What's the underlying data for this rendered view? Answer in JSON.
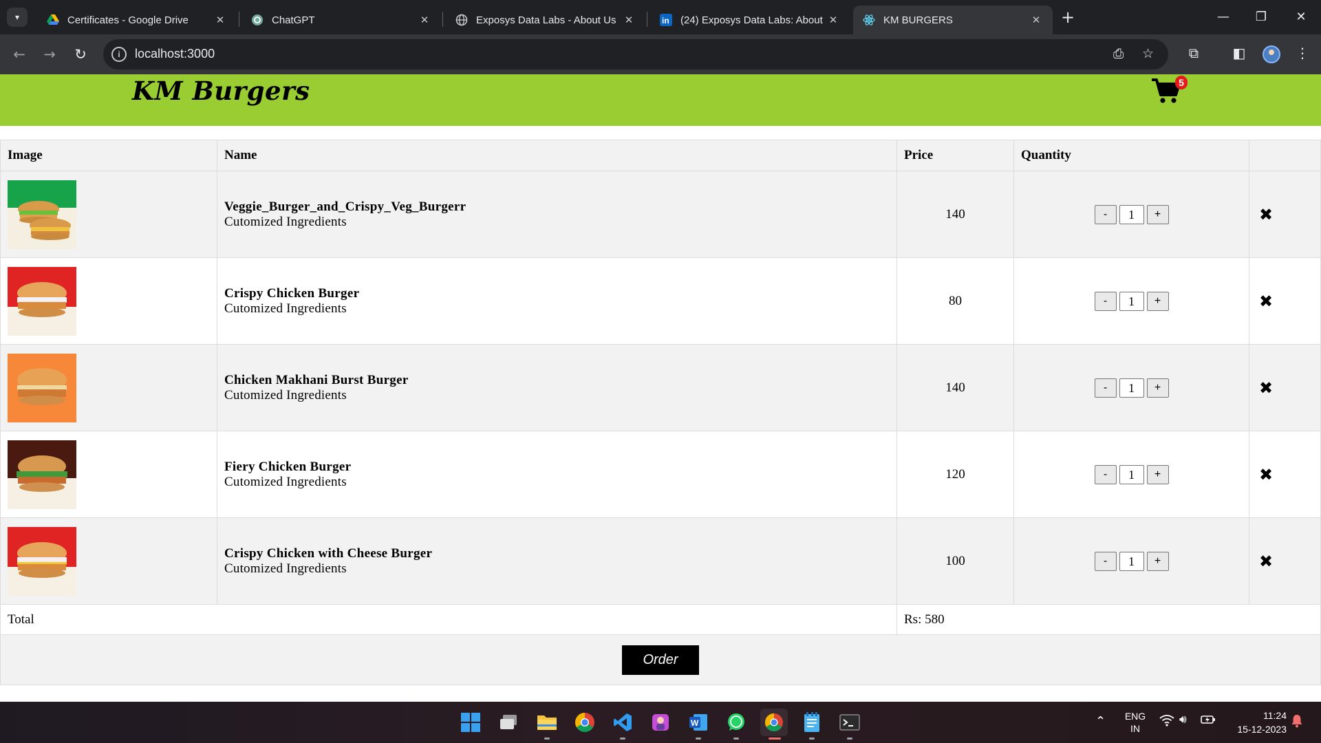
{
  "browser": {
    "tabs": [
      {
        "title": "Certificates - Google Drive",
        "icon": "google-drive-icon"
      },
      {
        "title": "ChatGPT",
        "icon": "chatgpt-icon"
      },
      {
        "title": "Exposys Data Labs - About Us",
        "icon": "globe-icon"
      },
      {
        "title": "(24) Exposys Data Labs: About |",
        "icon": "linkedin-icon"
      },
      {
        "title": "KM BURGERS",
        "icon": "react-icon",
        "active": true
      }
    ],
    "url": "localhost:3000"
  },
  "site": {
    "brand": "KM Burgers",
    "cart_count": "5",
    "accent_color": "#9acd32"
  },
  "table": {
    "headers": {
      "image": "Image",
      "name": "Name",
      "price": "Price",
      "quantity": "Quantity"
    },
    "items": [
      {
        "name": "Veggie_Burger_and_Crispy_Veg_Burgerr",
        "subtitle": "Cutomized Ingredients",
        "price": "140",
        "qty": "1",
        "image": "veggie-burger-image"
      },
      {
        "name": "Crispy Chicken Burger",
        "subtitle": "Cutomized Ingredients",
        "price": "80",
        "qty": "1",
        "image": "crispy-chicken-burger-image"
      },
      {
        "name": "Chicken Makhani Burst Burger",
        "subtitle": "Cutomized Ingredients",
        "price": "140",
        "qty": "1",
        "image": "chicken-makhani-burger-image"
      },
      {
        "name": "Fiery Chicken Burger",
        "subtitle": "Cutomized Ingredients",
        "price": "120",
        "qty": "1",
        "image": "fiery-chicken-burger-image"
      },
      {
        "name": "Crispy Chicken with Cheese Burger",
        "subtitle": "Cutomized Ingredients",
        "price": "100",
        "qty": "1",
        "image": "crispy-chicken-cheese-burger-image"
      }
    ],
    "qty_minus": "-",
    "qty_plus": "+",
    "remove_icon": "✖",
    "total_label": "Total",
    "total_value": "Rs: 580",
    "order_label": "Order"
  },
  "taskbar": {
    "lang_line1": "ENG",
    "lang_line2": "IN",
    "time": "11:24",
    "date": "15-12-2023"
  }
}
